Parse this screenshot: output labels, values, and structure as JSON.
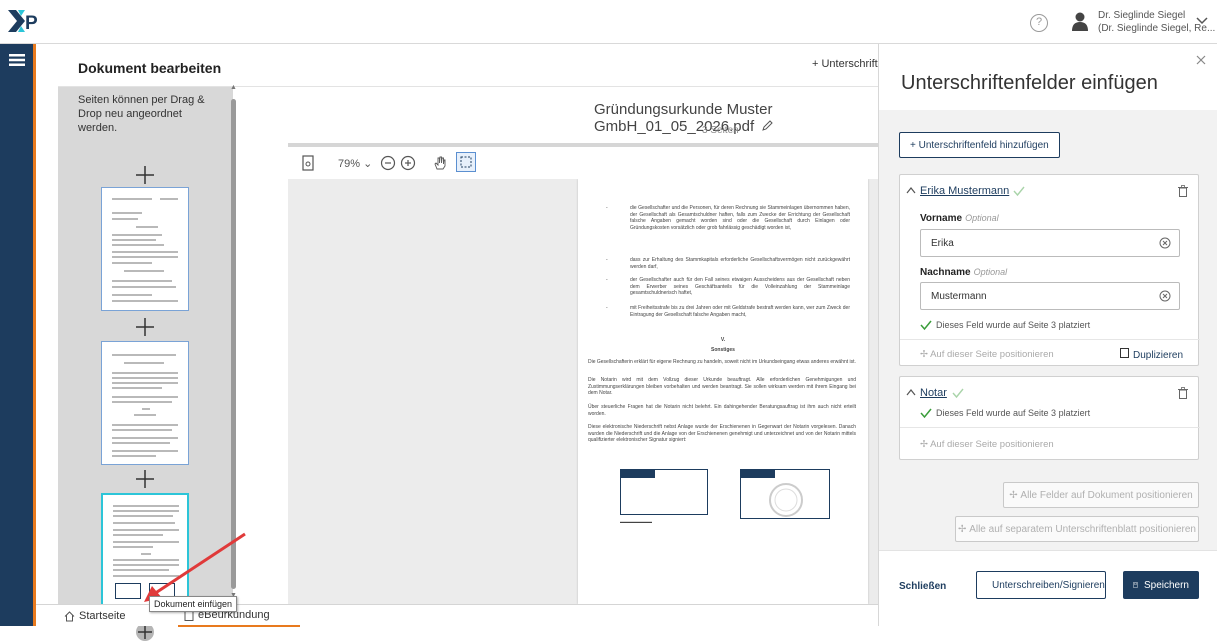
{
  "app": {
    "logo": "XP"
  },
  "header": {
    "user_line1": "Dr. Sieglinde Siegel",
    "user_line2": "(Dr. Sieglinde Siegel, Re..."
  },
  "editor": {
    "title": "Dokument bearbeiten",
    "add_signature_link": "+ Unterschrifte",
    "pages_hint": "Seiten können per Drag & Drop neu angeordnet werden.",
    "doc_name": "Gründungsurkunde Muster GmbH_01_05_2026.pdf",
    "page_count": "3 Seiten",
    "zoom": "79%"
  },
  "page_content": {
    "bullets": [
      "die Gesellschafter und die Personen, für deren Rechnung sie Stammeinlagen übernommen haben, der Gesellschaft als Gesamtschuldner haften, falls zum Zwecke der Errichtung der Gesellschaft falsche Angaben gemacht worden sind oder die Gesellschaft durch Einlagen oder Gründungskosten vorsätzlich oder grob fahrlässig geschädigt worden ist,",
      "dass zur Erhaltung des Stammkapitals erforderliche Gesellschaftsvermögen nicht zurückgewährt werden darf,",
      "der Gesellschafter auch für den Fall seines etwaigen Ausscheidens aus der Gesellschaft neben dem Erwerber seines Geschäftsanteils für die Volleinzahlung der Stammeinlage gesamtschuldnerisch haftet,",
      "mit Freiheitsstrafe bis zu drei Jahren oder mit Geldstrafe bestraft werden kann, wer zum Zweck der Eintragung der Gesellschaft falsche Angaben macht,"
    ],
    "section_num": "V.",
    "section_title": "Sonstiges",
    "paragraphs": [
      "Die Gesellschafterin erklärt für eigene Rechnung zu handeln, soweit nicht im Urkundseingang etwas anderes erwähnt ist.",
      "Die Notarin wird mit dem Vollzug dieser Urkunde beauftragt. Alle erforderlichen Genehmigungen und Zustimmungserklärungen bleiben vorbehalten und werden beantragt. Sie sollen wirksam werden mit ihrem Eingang bei dem Notar.",
      "Über steuerliche Fragen hat die Notarin nicht belehrt. Ein dahingehender Beratungsauftrag ist ihm auch nicht erteilt worden.",
      "Diese elektronische Niederschrift nebst Anlage wurde der Erschienenen in Gegenwart der Notarin vorgelesen. Danach wurden die Niederschrift und die Anlage von der Erschienenen genehmigt und unterzeichnet und von der Notarin mittels qualifizierter elektronischer Signatur signiert:"
    ]
  },
  "side_panel": {
    "title": "Unterschriftenfelder einfügen",
    "add_field_button": "+ Unterschriftenfeld hinzufügen",
    "cards": [
      {
        "name": "Erika Mustermann",
        "first_name_label": "Vorname",
        "first_name_optional": "Optional",
        "first_name_value": "Erika",
        "last_name_label": "Nachname",
        "last_name_optional": "Optional",
        "last_name_value": "Mustermann",
        "placed_text": "Dieses Feld wurde auf Seite 3 platziert",
        "position_link": "Auf dieser Seite positionieren",
        "duplicate_link": "Duplizieren"
      },
      {
        "name": "Notar",
        "placed_text": "Dieses Feld wurde auf Seite 3 platziert",
        "position_link": "Auf dieser Seite positionieren"
      }
    ],
    "all_on_document": "Alle Felder auf Dokument positionieren",
    "all_on_separate": "Alle auf separatem Unterschriftenblatt positionieren",
    "close": "Schließen",
    "sign_button": "Unterschreiben/Signieren",
    "save_button": "Speichern"
  },
  "bottom_tabs": [
    "Startseite",
    "eBeurkundung"
  ],
  "tooltip": "Dokument einfügen",
  "colors": {
    "navy": "#1d3c5e",
    "accent": "#e87a1e",
    "active_thumb": "#2cc5d8",
    "success": "#3a9d3a"
  }
}
